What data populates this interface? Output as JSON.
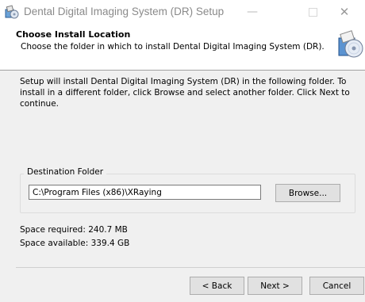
{
  "window": {
    "title": "Dental Digital Imaging System (DR) Setup",
    "controls": {
      "minimize": "—",
      "close": "✕"
    }
  },
  "header": {
    "title": "Choose Install Location",
    "subtitle": "Choose the folder in which to install Dental Digital Imaging System (DR)."
  },
  "body": {
    "intro": "Setup will install Dental Digital Imaging System (DR) in the following folder. To install in a different folder, click Browse and select another folder. Click Next to continue.",
    "destination": {
      "group_label": "Destination Folder",
      "path": "C:\\Program Files (x86)\\XRaying",
      "browse_label": "Browse..."
    },
    "space_required": "Space required: 240.7 MB",
    "space_available": "Space available: 339.4 GB"
  },
  "footer": {
    "back_label": "< Back",
    "next_label": "Next >",
    "cancel_label": "Cancel"
  },
  "icons": {
    "app": "installer-icon",
    "header": "installer-disc-icon"
  }
}
